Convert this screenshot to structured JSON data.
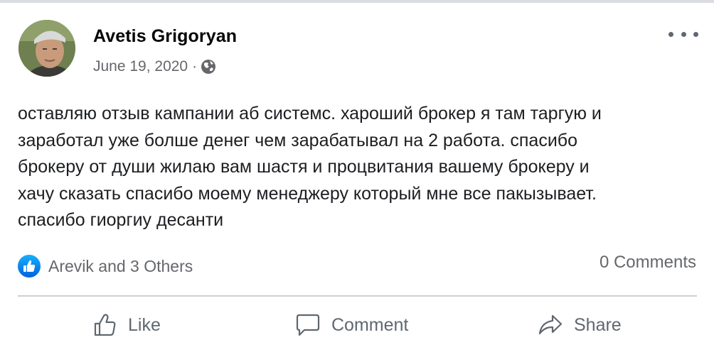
{
  "post": {
    "author_name": "Avetis Grigoryan",
    "date": "June 19, 2020",
    "separator": "·",
    "privacy_icon": "globe-icon",
    "menu_icon": "more-options-icon",
    "text_lines": [
      "оставляю отзыв кампании аб системс. хароший брокер я там таргую и",
      "заработал уже болше денег чем зарабатывал на 2 работа. спасибо",
      "брокеру от души жилаю вам шастя и процвитания вашему брокеру и",
      "хачу сказать спасибо моему менеджеру который мне все пакызывает.",
      "спасибо гиоргиу десанти"
    ]
  },
  "engagement": {
    "reaction_icon": "like-reaction-icon",
    "reactions_text": "Arevik and 3 Others",
    "comments_text": "0 Comments"
  },
  "actions": {
    "like_label": "Like",
    "comment_label": "Comment",
    "share_label": "Share"
  },
  "colors": {
    "text": "#1c1e21",
    "secondary_text": "#65676b",
    "like_blue": "#1877f2",
    "divider": "#ced0d4"
  }
}
